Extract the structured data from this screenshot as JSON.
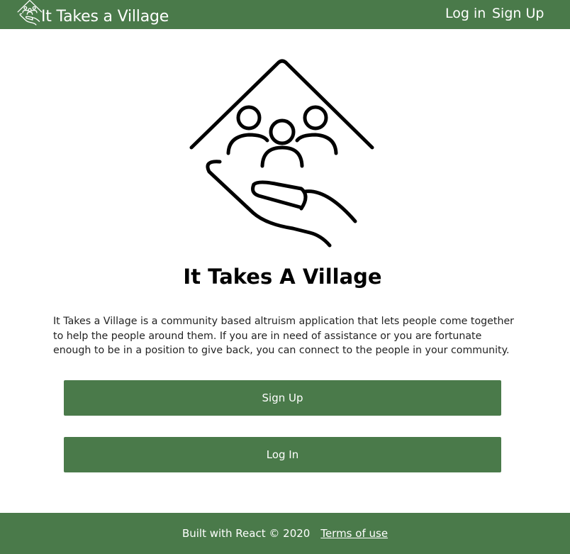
{
  "navbar": {
    "brand_icon": "hand-people-house-icon",
    "brand_text": "It Takes a Village",
    "login_label": "Log in",
    "signup_label": "Sign Up"
  },
  "hero": {
    "logo_icon": "hand-people-house-icon",
    "title": "It Takes A Village",
    "description": "It Takes a Village is a community based altruism application that lets people come together to help the people around them. If you are in need of assistance or you are fortunate enough to be in a position to give back, you can connect to the people in your community."
  },
  "actions": {
    "signup_label": "Sign Up",
    "login_label": "Log In"
  },
  "footer": {
    "text": "Built with React © 2020",
    "terms_label": "Terms of use"
  },
  "colors": {
    "brand_green": "#4a7a4a",
    "text_dark": "#000000",
    "on_brand": "#ffffff"
  }
}
